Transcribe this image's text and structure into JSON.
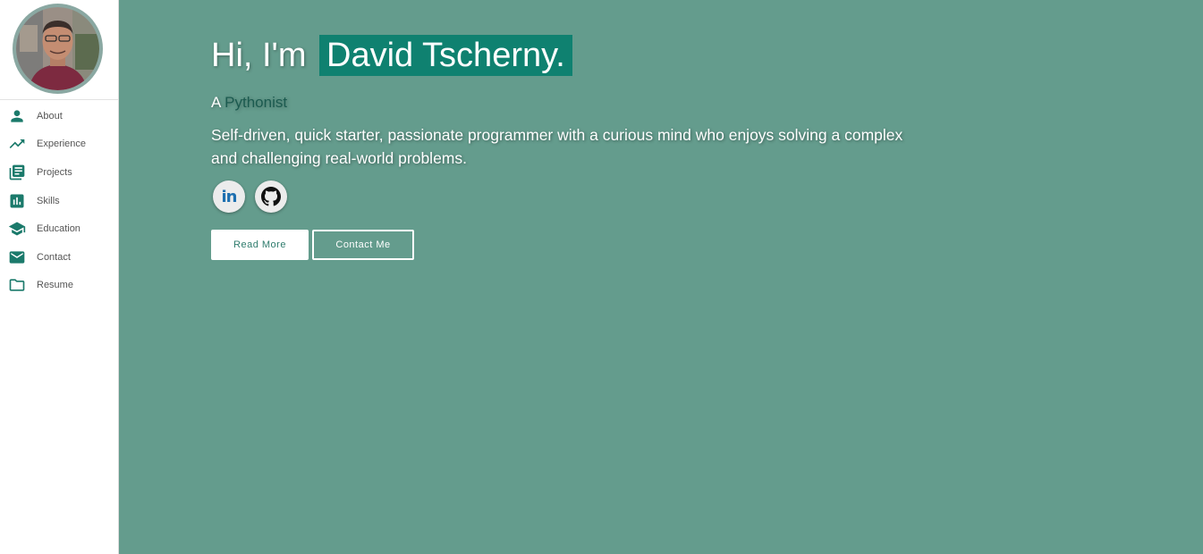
{
  "sidebar": {
    "avatar_alt": "profile photo",
    "items": [
      {
        "label": "About",
        "icon": "person-icon"
      },
      {
        "label": "Experience",
        "icon": "trending-up-icon"
      },
      {
        "label": "Projects",
        "icon": "library-books-icon"
      },
      {
        "label": "Skills",
        "icon": "bar-chart-icon"
      },
      {
        "label": "Education",
        "icon": "school-icon"
      },
      {
        "label": "Contact",
        "icon": "mail-icon"
      },
      {
        "label": "Resume",
        "icon": "folder-icon"
      }
    ]
  },
  "hero": {
    "greeting": "Hi, I'm",
    "name": "David Tscherny.",
    "role_prefix": "A",
    "role": "Pythonist",
    "bio": "Self-driven, quick starter, passionate programmer with a curious mind who enjoys solving a complex and challenging real-world problems.",
    "socials": [
      {
        "name": "LinkedIn",
        "icon": "linkedin-icon",
        "glyph": "in"
      },
      {
        "name": "GitHub",
        "icon": "github-icon"
      }
    ],
    "buttons": {
      "read_more": "Read More",
      "contact_me": "Contact Me"
    }
  },
  "colors": {
    "background": "#649c8d",
    "accent": "#0f8170",
    "icon": "#1b7a6b",
    "sidebar": "#ffffff"
  }
}
